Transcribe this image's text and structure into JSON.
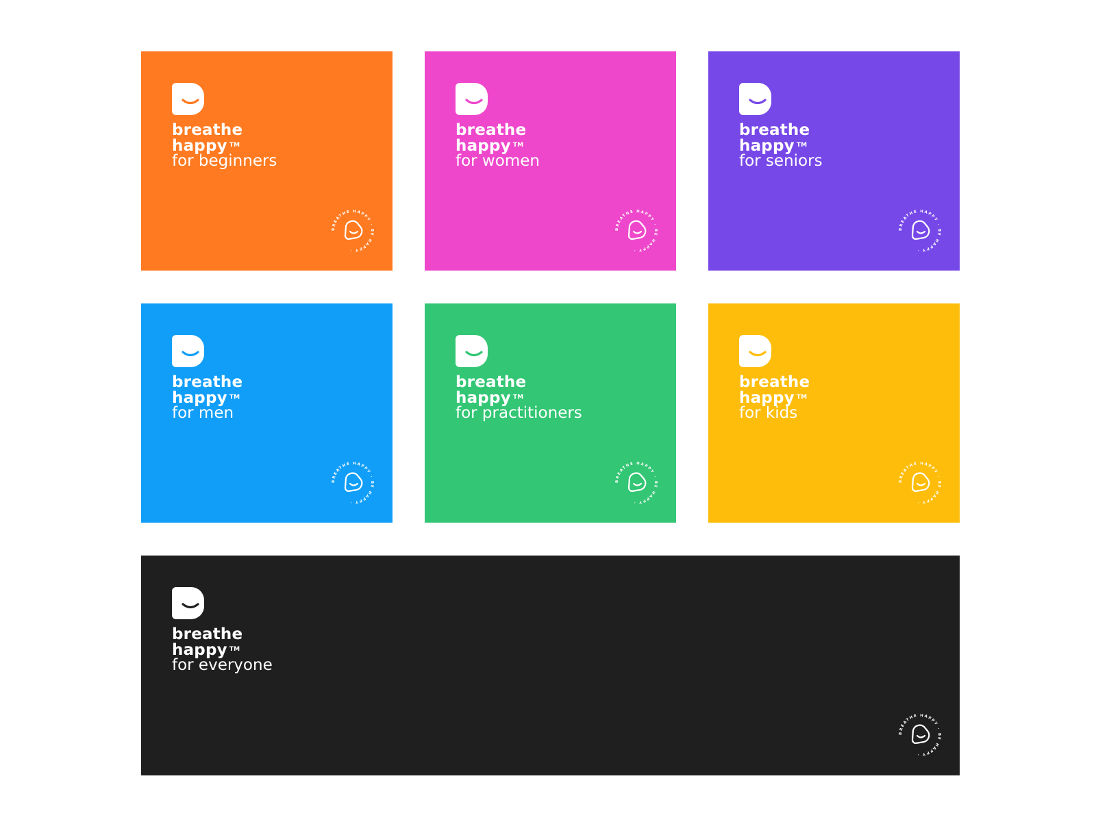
{
  "brand": {
    "line1": "breathe",
    "line2": "happy",
    "tm": "TM",
    "seal_text": "BREATHE HAPPY · BE HAPPY ·"
  },
  "cards": [
    {
      "subtitle": "for beginners",
      "bg": "#FF7A20",
      "smile": "#FF7A20"
    },
    {
      "subtitle": "for women",
      "bg": "#EE47CB",
      "smile": "#EE47CB"
    },
    {
      "subtitle": "for seniors",
      "bg": "#7748E8",
      "smile": "#7748E8"
    },
    {
      "subtitle": "for men",
      "bg": "#119EF8",
      "smile": "#119EF8"
    },
    {
      "subtitle": "for practitioners",
      "bg": "#33C674",
      "smile": "#33C674"
    },
    {
      "subtitle": "for kids",
      "bg": "#FEBD0A",
      "smile": "#FEBD0A"
    },
    {
      "subtitle": "for everyone",
      "bg": "#1F1F1F",
      "smile": "#1F1F1F"
    }
  ],
  "icons": {
    "logo": "smile-b-logo-icon",
    "seal": "circular-seal-icon"
  }
}
